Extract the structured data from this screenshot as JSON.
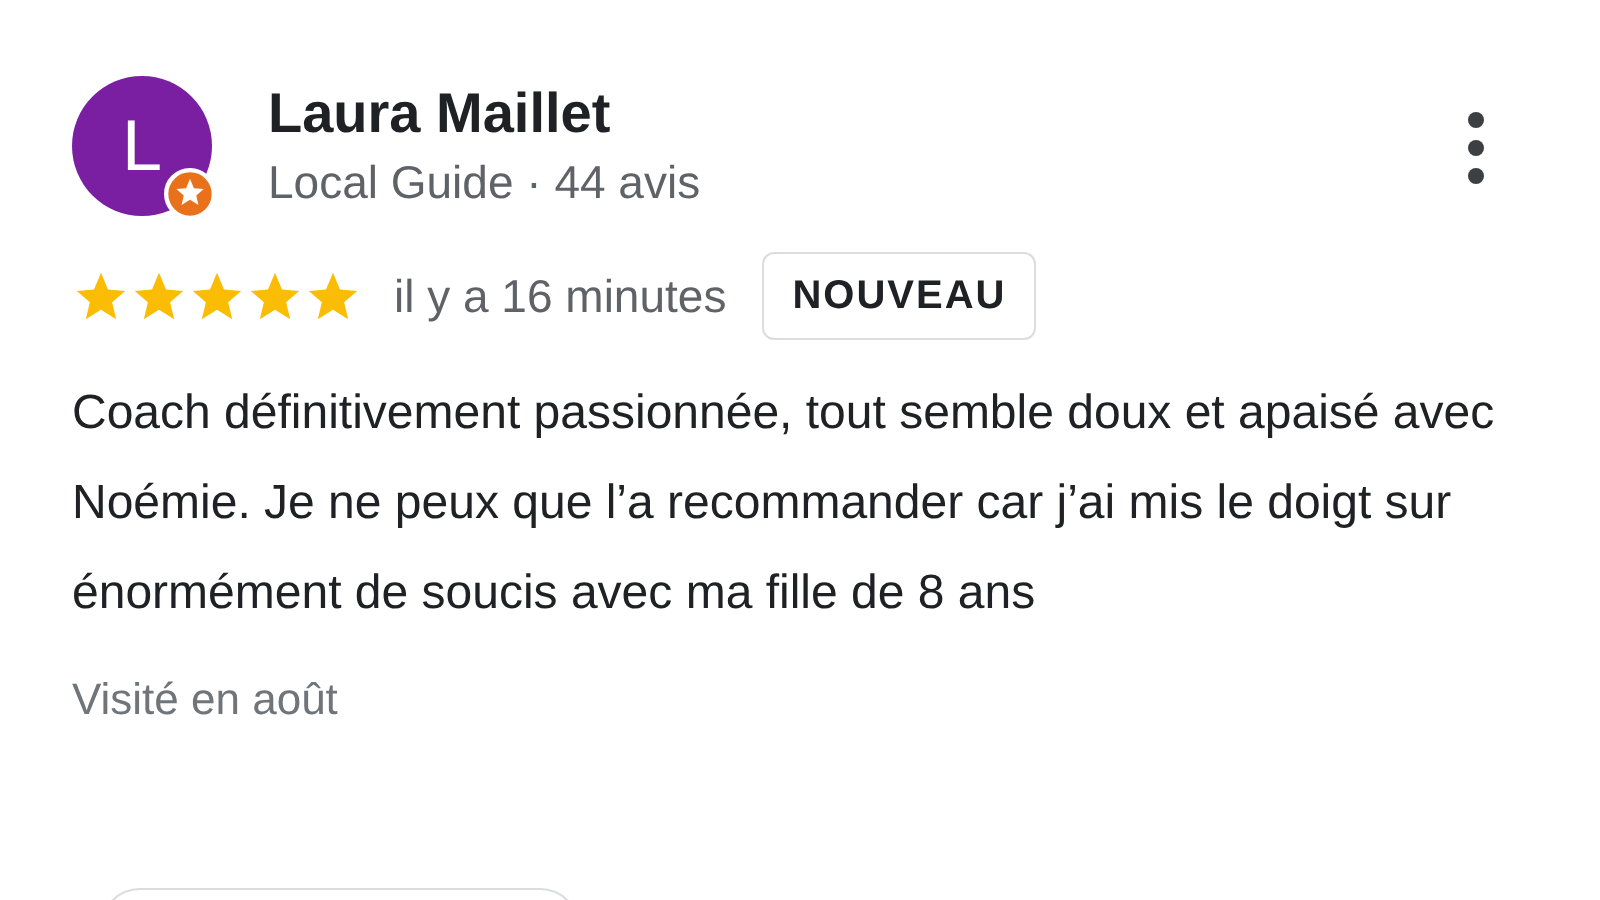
{
  "review": {
    "avatar_letter": "L",
    "local_guide": true,
    "name": "Laura Maillet",
    "subtitle": "Local Guide · 44 avis",
    "stars": 5,
    "time": "il y a 16 minutes",
    "badge": "NOUVEAU",
    "text": "Coach définitivement passionnée, tout semble doux et apaisé avec Noémie. Je ne peux que l’a recommander car j’ai mis le doigt sur énormément de soucis avec ma fille de 8 ans",
    "visited": "Visité en août"
  }
}
